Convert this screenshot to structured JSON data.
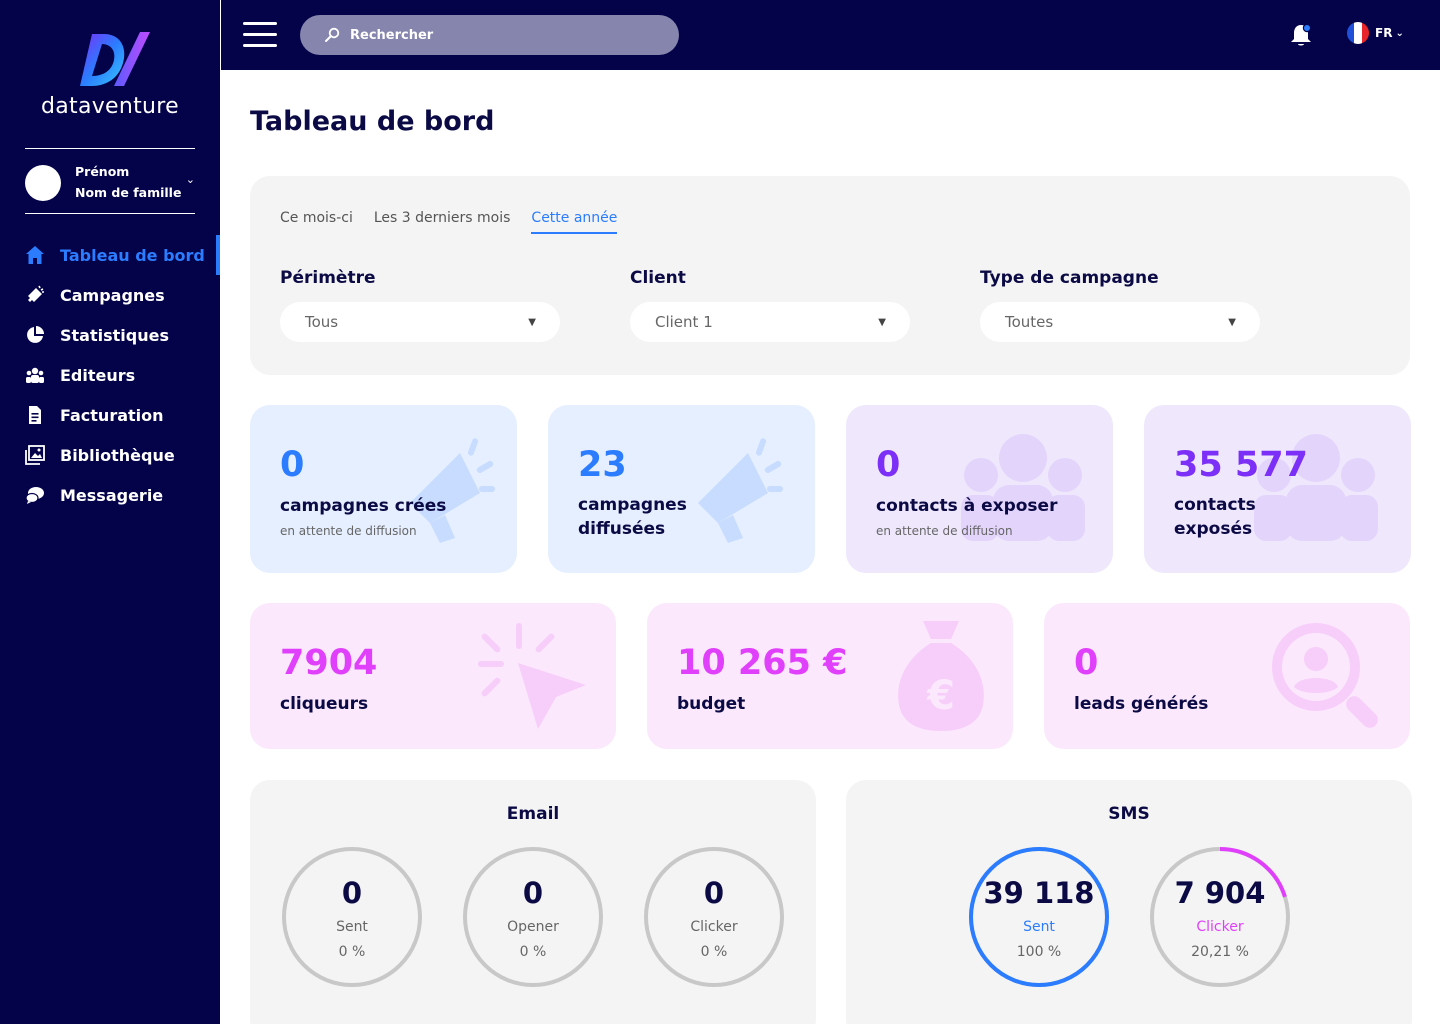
{
  "brand": {
    "name": "dataventure"
  },
  "user": {
    "first_name": "Prénom",
    "last_name": "Nom de famille"
  },
  "sidebar": {
    "items": [
      {
        "label": "Tableau de bord",
        "icon": "home-icon"
      },
      {
        "label": "Campagnes",
        "icon": "megaphone-icon"
      },
      {
        "label": "Statistiques",
        "icon": "pie-chart-icon"
      },
      {
        "label": "Editeurs",
        "icon": "users-icon"
      },
      {
        "label": "Facturation",
        "icon": "invoice-icon"
      },
      {
        "label": "Bibliothèque",
        "icon": "image-library-icon"
      },
      {
        "label": "Messagerie",
        "icon": "chat-icon"
      }
    ]
  },
  "topbar": {
    "search_placeholder": "Rechercher",
    "language": "FR"
  },
  "page": {
    "title": "Tableau de bord"
  },
  "filters": {
    "tabs": [
      {
        "label": "Ce mois-ci"
      },
      {
        "label": "Les 3 derniers mois"
      },
      {
        "label": "Cette année"
      }
    ],
    "perimetre": {
      "label": "Périmètre",
      "value": "Tous"
    },
    "client": {
      "label": "Client",
      "value": "Client 1"
    },
    "type": {
      "label": "Type de campagne",
      "value": "Toutes"
    }
  },
  "stats": {
    "campagnes_creees": {
      "value": "0",
      "label": "campagnes crées",
      "sub": "en attente de diffusion"
    },
    "campagnes_diffusees": {
      "value": "23",
      "label_1": "campagnes",
      "label_2": "diffusées"
    },
    "contacts_a_exposer": {
      "value": "0",
      "label": "contacts à exposer",
      "sub": "en attente de diffusion"
    },
    "contacts_exposes": {
      "value": "35 577",
      "label_1": "contacts",
      "label_2": "exposés"
    },
    "cliqueurs": {
      "value": "7904",
      "label": "cliqueurs"
    },
    "budget": {
      "value": "10 265 €",
      "label": "budget"
    },
    "leads": {
      "value": "0",
      "label": "leads générés"
    }
  },
  "email": {
    "title": "Email",
    "metrics": [
      {
        "value": "0",
        "label": "Sent",
        "percent": "0 %",
        "fraction": 0
      },
      {
        "value": "0",
        "label": "Opener",
        "percent": "0 %",
        "fraction": 0
      },
      {
        "value": "0",
        "label": "Clicker",
        "percent": "0 %",
        "fraction": 0
      }
    ]
  },
  "sms": {
    "title": "SMS",
    "metrics": [
      {
        "value": "39 118",
        "label": "Sent",
        "percent": "100 %",
        "fraction": 1.0
      },
      {
        "value": "7 904",
        "label": "Clicker",
        "percent": "20,21 %",
        "fraction": 0.2021
      }
    ]
  },
  "colors": {
    "navy": "#04034a",
    "blue": "#2b7cff",
    "purple": "#7b2ff7",
    "magenta": "#e040fb",
    "ring_gray": "#c8c8c8"
  }
}
